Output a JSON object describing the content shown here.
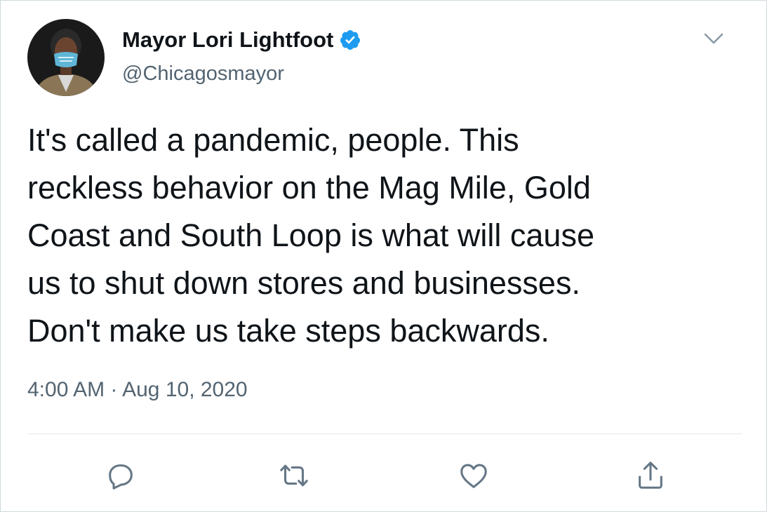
{
  "tweet": {
    "display_name": "Mayor Lori Lightfoot",
    "handle": "@Chicagosmayor",
    "text": "It's called a pandemic, people. This\nreckless behavior on the Mag Mile, Gold\nCoast and South Loop is what will cause\nus to shut down stores and businesses.\nDon't make us take steps backwards.",
    "time": "4:00 AM",
    "separator": "·",
    "date": "Aug 10, 2020"
  },
  "icons": {
    "verified": "verified-badge-icon",
    "more": "chevron-down-icon",
    "reply": "reply-icon",
    "retweet": "retweet-icon",
    "like": "heart-icon",
    "share": "share-icon"
  },
  "colors": {
    "verified": "#1d9bf0",
    "text": "#0f1419",
    "secondary": "#536471",
    "icon": "#657786"
  }
}
